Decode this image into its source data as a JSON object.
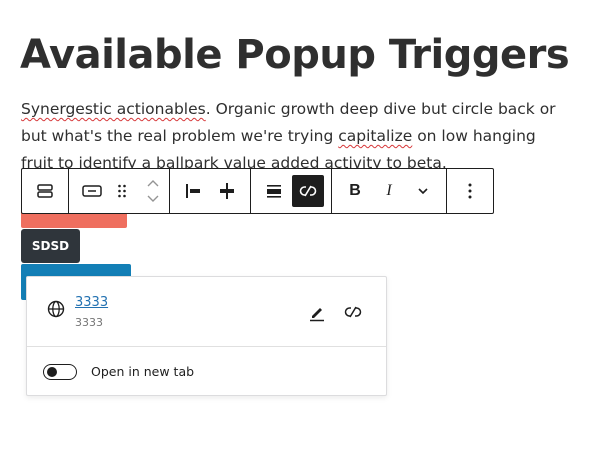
{
  "page": {
    "heading": "Available Popup Triggers",
    "paragraph": {
      "misspelled_1": "Synergestic actionables",
      "text_1": ". Organic growth deep dive but circle back or but what's the real problem we're trying ",
      "misspelled_2": "capitalize",
      "text_2": " on low hanging fruit to identify a ballpark value added activity to beta."
    }
  },
  "buttons": {
    "dark_label": "SDSD"
  },
  "toolbar": {
    "icons": [
      "block-switcher-icon",
      "button-block-icon",
      "drag-handle-icon",
      "move-up-icon",
      "move-down-icon",
      "justify-left-icon",
      "justify-center-icon",
      "align-icon",
      "unlink-icon",
      "bold-icon",
      "italic-icon",
      "more-rich-text-icon",
      "options-icon"
    ],
    "bold_glyph": "B",
    "italic_glyph": "I",
    "active_color": "#1e1e1e"
  },
  "link_popover": {
    "title": "3333",
    "url": "3333",
    "open_new_tab_label": "Open in new tab",
    "open_new_tab_checked": false
  },
  "colors": {
    "red_button": "#ef6f5f",
    "dark_button": "#2f353b",
    "blue_button": "#137fb6",
    "link": "#2271b1"
  }
}
